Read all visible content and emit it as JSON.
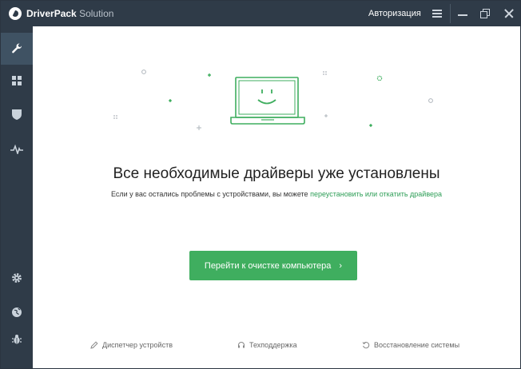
{
  "app": {
    "brand_bold": "DriverPack",
    "brand_light": "Solution"
  },
  "titlebar": {
    "auth_label": "Авторизация",
    "menu_icon": "hamburger-icon",
    "minimize_icon": "minimize-icon",
    "restore_icon": "restore-icon",
    "close_icon": "close-icon"
  },
  "sidebar": {
    "items": [
      {
        "name": "wrench-icon",
        "active": true
      },
      {
        "name": "grid-icon",
        "active": false
      },
      {
        "name": "shield-icon",
        "active": false
      },
      {
        "name": "activity-icon",
        "active": false
      },
      {
        "name": "gear-icon",
        "active": false
      },
      {
        "name": "globe-icon",
        "active": false
      },
      {
        "name": "bug-icon",
        "active": false
      }
    ]
  },
  "main": {
    "headline": "Все необходимые драйверы уже установлены",
    "subtext_prefix": "Если у вас остались проблемы с устройствами, вы можете ",
    "subtext_link": "переустановить или откатить драйвера",
    "cta_label": "Перейти к очистке компьютера",
    "cta_chevron": "›"
  },
  "footer": {
    "device_manager": "Диспетчер устройств",
    "support": "Техподдержка",
    "restore": "Восстановление системы"
  },
  "colors": {
    "accent": "#3fae5f",
    "sidebar_bg": "#2f3b48",
    "link": "#2e9e57"
  }
}
